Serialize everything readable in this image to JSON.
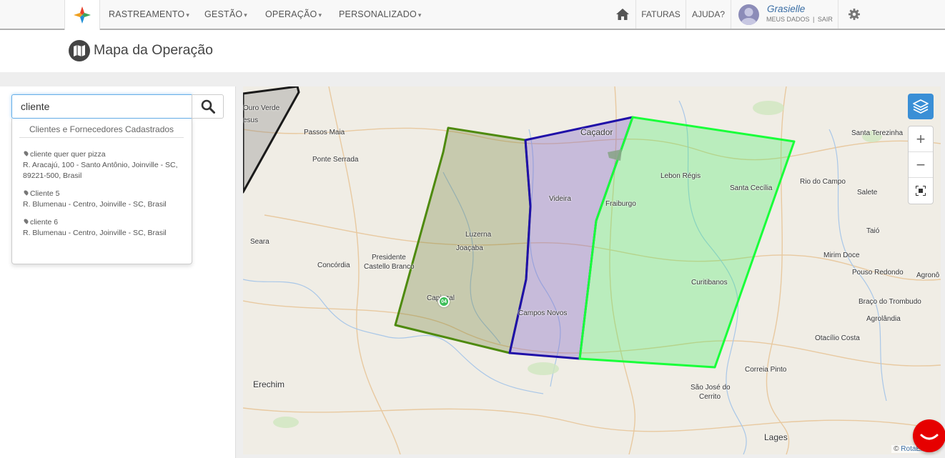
{
  "nav": {
    "menu": [
      {
        "label": "RASTREAMENTO",
        "chevron": "▾"
      },
      {
        "label": "GESTÃO",
        "chevron": "▾"
      },
      {
        "label": "OPERAÇÃO",
        "chevron": "▾"
      },
      {
        "label": "PERSONALIZADO",
        "chevron": "▾"
      }
    ],
    "home_icon": "home-icon",
    "faturas": "FATURAS",
    "ajuda": "AJUDA?",
    "user": {
      "name": "Grasielle",
      "meus_dados": "MEUS DADOS",
      "separator": "|",
      "sair": "SAIR"
    },
    "settings_icon": "gear-icon"
  },
  "page": {
    "title": "Mapa da Operação",
    "title_icon": "map-icon"
  },
  "search": {
    "value": "cliente",
    "button_icon": "search-icon",
    "dropdown_header": "Clientes e Fornecedores Cadastrados",
    "results": [
      {
        "name": "cliente quer quer pizza",
        "address": "R. Aracajú, 100 - Santo Antônio, Joinville - SC, 89221-500, Brasil"
      },
      {
        "name": "Cliente 5",
        "address": "R. Blumenau - Centro, Joinville - SC, Brasil"
      },
      {
        "name": "cliente 6",
        "address": "R. Blumenau - Centro, Joinville - SC, Brasil"
      }
    ]
  },
  "map": {
    "cities": [
      {
        "name": "Ouro Verde"
      },
      {
        "name": "esus"
      },
      {
        "name": "Passos Maia"
      },
      {
        "name": "Ponte Serrada"
      },
      {
        "name": "Caçador"
      },
      {
        "name": "Santa Terezinha"
      },
      {
        "name": "Lebon Régis"
      },
      {
        "name": "Santa Cecília"
      },
      {
        "name": "Rio do Campo"
      },
      {
        "name": "Salete"
      },
      {
        "name": "Videira"
      },
      {
        "name": "Fraiburgo"
      },
      {
        "name": "Taió"
      },
      {
        "name": "Seara"
      },
      {
        "name": "Luzerna"
      },
      {
        "name": "Joaçaba"
      },
      {
        "name": "Presidente"
      },
      {
        "name": "Castello Branco"
      },
      {
        "name": "Concórdia"
      },
      {
        "name": "Mirim Doce"
      },
      {
        "name": "Pouso Redondo"
      },
      {
        "name": "Agronô"
      },
      {
        "name": "Curitibanos"
      },
      {
        "name": "Capinzal"
      },
      {
        "name": "Braço do Trombudo"
      },
      {
        "name": "Campos Novos"
      },
      {
        "name": "Agrolândia"
      },
      {
        "name": "Otacílio Costa"
      },
      {
        "name": "Erechim"
      },
      {
        "name": "Correia Pinto"
      },
      {
        "name": "São José do"
      },
      {
        "name": "Cerrito"
      },
      {
        "name": "Lages"
      }
    ],
    "marker_label": "04",
    "layers_icon": "layers-icon",
    "zoom_in": "+",
    "zoom_out": "−",
    "fullscreen_icon": "fullscreen-icon",
    "attribution_prefix": "©",
    "attribution_brand": "RotaExata",
    "zone_colors": {
      "olive": "#4e8a0e",
      "purple": "#1f0fa8",
      "green": "#19ff3a",
      "gray": "#1a1a1a"
    }
  },
  "chat_icon": "chat-icon"
}
